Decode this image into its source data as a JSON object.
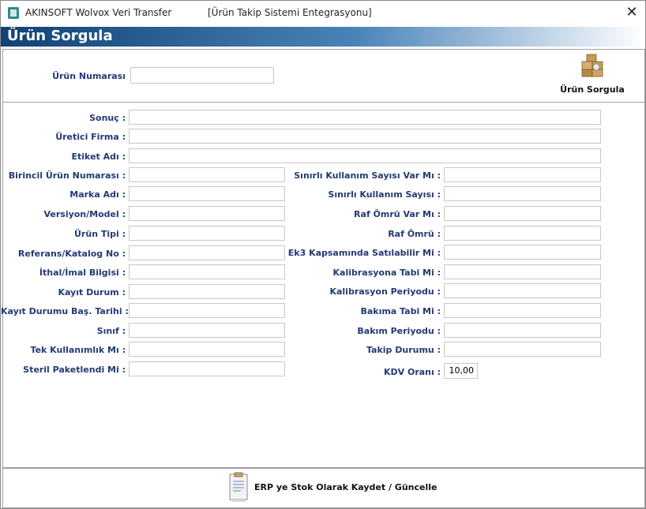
{
  "window": {
    "app_title": "AKINSOFT Wolvox Veri Transfer",
    "subtitle": "[Ürün Takip Sistemi Entegrasyonu]",
    "close_glyph": "✕"
  },
  "header": {
    "title": "Ürün Sorgula"
  },
  "search": {
    "label": "Ürün Numarası",
    "value": "",
    "button_label": "Ürün Sorgula",
    "button_icon": "boxes-icon"
  },
  "fields": {
    "sonuc": {
      "label": "Sonuç :",
      "value": ""
    },
    "uretici_firma": {
      "label": "Üretici Firma :",
      "value": ""
    },
    "etiket_adi": {
      "label": "Etiket Adı :",
      "value": ""
    },
    "birincil_urun_numarasi": {
      "label": "Birincil Ürün Numarası :",
      "value": ""
    },
    "marka_adi": {
      "label": "Marka Adı :",
      "value": ""
    },
    "versiyon_model": {
      "label": "Versiyon/Model :",
      "value": ""
    },
    "urun_tipi": {
      "label": "Ürün Tipi :",
      "value": ""
    },
    "referans_katalog_no": {
      "label": "Referans/Katalog No :",
      "value": ""
    },
    "ithal_imal_bilgisi": {
      "label": "İthal/İmal Bilgisi :",
      "value": ""
    },
    "kayit_durum": {
      "label": "Kayıt Durum :",
      "value": ""
    },
    "kayit_durumu_bas_tarihi": {
      "label": "Kayıt Durumu Baş. Tarihi :",
      "value": ""
    },
    "sinif": {
      "label": "Sınıf :",
      "value": ""
    },
    "tek_kullanimlik_mi": {
      "label": "Tek Kullanımlık Mı :",
      "value": ""
    },
    "steril_paketlendi_mi": {
      "label": "Steril Paketlendi Mi :",
      "value": ""
    },
    "sinirli_kullanim_sayisi_var_mi": {
      "label": "Sınırlı Kullanım Sayısı Var Mı :",
      "value": ""
    },
    "sinirli_kullanim_sayisi": {
      "label": "Sınırlı Kullanım Sayısı :",
      "value": ""
    },
    "raf_omru_var_mi": {
      "label": "Raf Ömrü Var Mı :",
      "value": ""
    },
    "raf_omru": {
      "label": "Raf Ömrü :",
      "value": ""
    },
    "ek3_kapsaminda_satilabilir_mi": {
      "label": "Ek3 Kapsamında Satılabilir Mi :",
      "value": ""
    },
    "kalibrasyona_tabi_mi": {
      "label": "Kalibrasyona Tabi Mi :",
      "value": ""
    },
    "kalibrasyon_periyodu": {
      "label": "Kalibrasyon Periyodu :",
      "value": ""
    },
    "bakima_tabi_mi": {
      "label": "Bakıma Tabi Mi :",
      "value": ""
    },
    "bakim_periyodu": {
      "label": "Bakım Periyodu :",
      "value": ""
    },
    "takip_durumu": {
      "label": "Takip Durumu :",
      "value": ""
    },
    "kdv_orani": {
      "label": "KDV Oranı :",
      "value": "10,00"
    }
  },
  "footer": {
    "save_button_label": "ERP ye Stok Olarak Kaydet / Güncelle",
    "save_button_icon": "clipboard-document-icon"
  },
  "colors": {
    "header_dark": "#114276",
    "label_blue": "#223a75",
    "app_icon": "#2f8a86"
  }
}
